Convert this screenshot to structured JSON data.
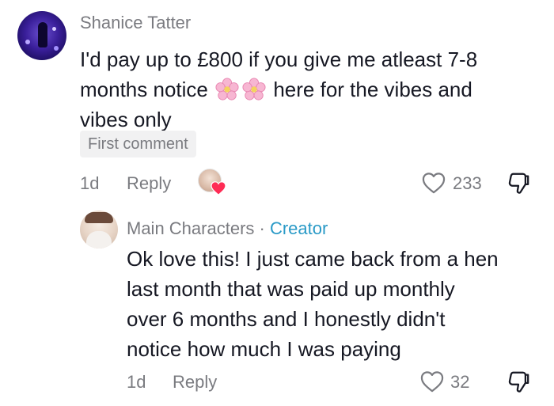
{
  "comment": {
    "author": "Shanice Tatter",
    "text_line1": "I'd pay up to £800 if you give me atleast 7-8",
    "text_line2_before": "months notice",
    "text_line2_after": "here for the vibes and",
    "text_line3": "vibes only",
    "badge": "First comment",
    "age": "1d",
    "reply_label": "Reply",
    "likes": "233"
  },
  "reply": {
    "author": "Main Characters",
    "separator": "·",
    "role": "Creator",
    "lines": [
      "Ok love this! I just came back from a hen",
      "last month that was paid up monthly",
      "over 6 months and I honestly didn't",
      "notice how much I was paying"
    ],
    "age": "1d",
    "reply_label": "Reply",
    "likes": "32"
  },
  "colors": {
    "text": "#161823",
    "muted": "#7a7b80",
    "creator": "#2a9ac7",
    "heart_red": "#fe2c55"
  },
  "icons": {
    "flowers": "cherry-blossom-emoji",
    "like": "heart-outline-icon",
    "dislike": "thumbs-down-icon",
    "creator_liked": "red-heart-icon"
  }
}
